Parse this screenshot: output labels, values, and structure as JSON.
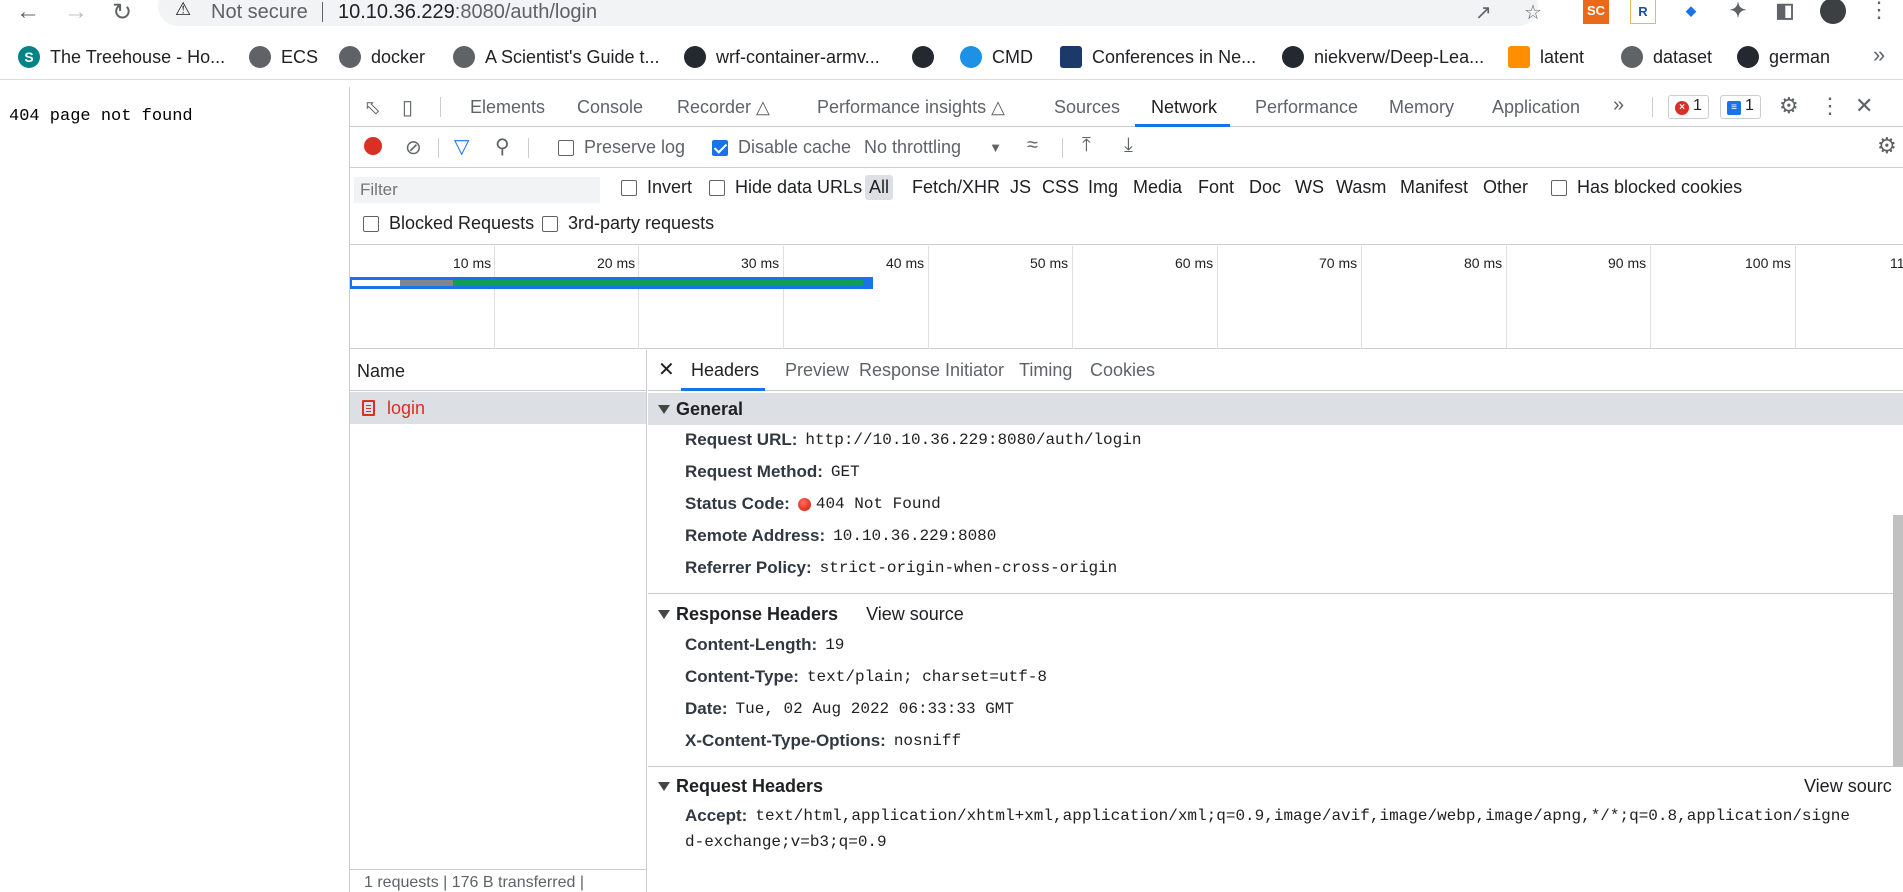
{
  "browser": {
    "not_secure": "Not secure",
    "url_host": "10.10.36.229",
    "url_rest": ":8080/auth/login",
    "ext_sc": "SC",
    "ext_r": "R"
  },
  "bookmarks": [
    {
      "label": "The Treehouse - Ho...",
      "icon": "sharepoint-icon",
      "color": "#038387",
      "glyph": "S"
    },
    {
      "label": "ECS",
      "icon": "globe-icon",
      "color": "#5f6368",
      "glyph": ""
    },
    {
      "label": "docker",
      "icon": "globe-icon",
      "color": "#5f6368",
      "glyph": ""
    },
    {
      "label": "A Scientist's Guide t...",
      "icon": "globe-icon",
      "color": "#5f6368",
      "glyph": ""
    },
    {
      "label": "wrf-container-armv...",
      "icon": "github-icon",
      "color": "#24292f",
      "glyph": ""
    },
    {
      "label": "",
      "icon": "github-icon",
      "color": "#24292f",
      "glyph": ""
    },
    {
      "label": "CMD",
      "icon": "docker-icon",
      "color": "#1d91e6",
      "glyph": ""
    },
    {
      "label": "Conferences in Ne...",
      "icon": "shield-icon",
      "color": "#1b3a6b",
      "glyph": ""
    },
    {
      "label": "niekverw/Deep-Lea...",
      "icon": "github-icon",
      "color": "#24292f",
      "glyph": ""
    },
    {
      "label": "latent",
      "icon": "tensorflow-icon",
      "color": "#ff8f00",
      "glyph": ""
    },
    {
      "label": "dataset",
      "icon": "globe-icon",
      "color": "#5f6368",
      "glyph": ""
    },
    {
      "label": "german",
      "icon": "github-icon",
      "color": "#24292f",
      "glyph": ""
    }
  ],
  "page": {
    "message": "404 page not found"
  },
  "devtools": {
    "tabs": [
      "Elements",
      "Console",
      "Recorder",
      "Performance insights",
      "Sources",
      "Network",
      "Performance",
      "Memory",
      "Application"
    ],
    "active_tab": "Network",
    "error_count": "1",
    "message_count": "1",
    "toolbar": {
      "preserve_log": "Preserve log",
      "disable_cache": "Disable cache",
      "throttling": "No throttling"
    },
    "filter": {
      "placeholder": "Filter",
      "invert": "Invert",
      "hide_data_urls": "Hide data URLs",
      "types": [
        "All",
        "Fetch/XHR",
        "JS",
        "CSS",
        "Img",
        "Media",
        "Font",
        "Doc",
        "WS",
        "Wasm",
        "Manifest",
        "Other"
      ],
      "has_blocked_cookies": "Has blocked cookies",
      "blocked_requests": "Blocked Requests",
      "third_party": "3rd-party requests"
    },
    "overview_ticks": [
      "10 ms",
      "20 ms",
      "30 ms",
      "40 ms",
      "50 ms",
      "60 ms",
      "70 ms",
      "80 ms",
      "90 ms",
      "100 ms",
      "11"
    ],
    "name_column": "Name",
    "request_name": "login",
    "footer": "1 requests  |  176 B transferred  |",
    "detail_tabs": [
      "Headers",
      "Preview",
      "Response",
      "Initiator",
      "Timing",
      "Cookies"
    ],
    "general": {
      "title": "General",
      "rows": [
        {
          "key": "Request URL:",
          "value": "http://10.10.36.229:8080/auth/login"
        },
        {
          "key": "Request Method:",
          "value": "GET"
        },
        {
          "key": "Status Code:",
          "value": "404 Not Found"
        },
        {
          "key": "Remote Address:",
          "value": "10.10.36.229:8080"
        },
        {
          "key": "Referrer Policy:",
          "value": "strict-origin-when-cross-origin"
        }
      ]
    },
    "response_headers": {
      "title": "Response Headers",
      "view_source": "View source",
      "rows": [
        {
          "key": "Content-Length:",
          "value": "19"
        },
        {
          "key": "Content-Type:",
          "value": "text/plain; charset=utf-8"
        },
        {
          "key": "Date:",
          "value": "Tue, 02 Aug 2022 06:33:33 GMT"
        },
        {
          "key": "X-Content-Type-Options:",
          "value": "nosniff"
        }
      ]
    },
    "request_headers": {
      "title": "Request Headers",
      "view_source": "View sourc",
      "rows": [
        {
          "key": "Accept:",
          "value": "text/html,application/xhtml+xml,application/xml;q=0.9,image/avif,image/webp,image/apng,*/*;q=0.8,application/signe"
        }
      ],
      "wrap": "d-exchange;v=b3;q=0.9"
    }
  }
}
